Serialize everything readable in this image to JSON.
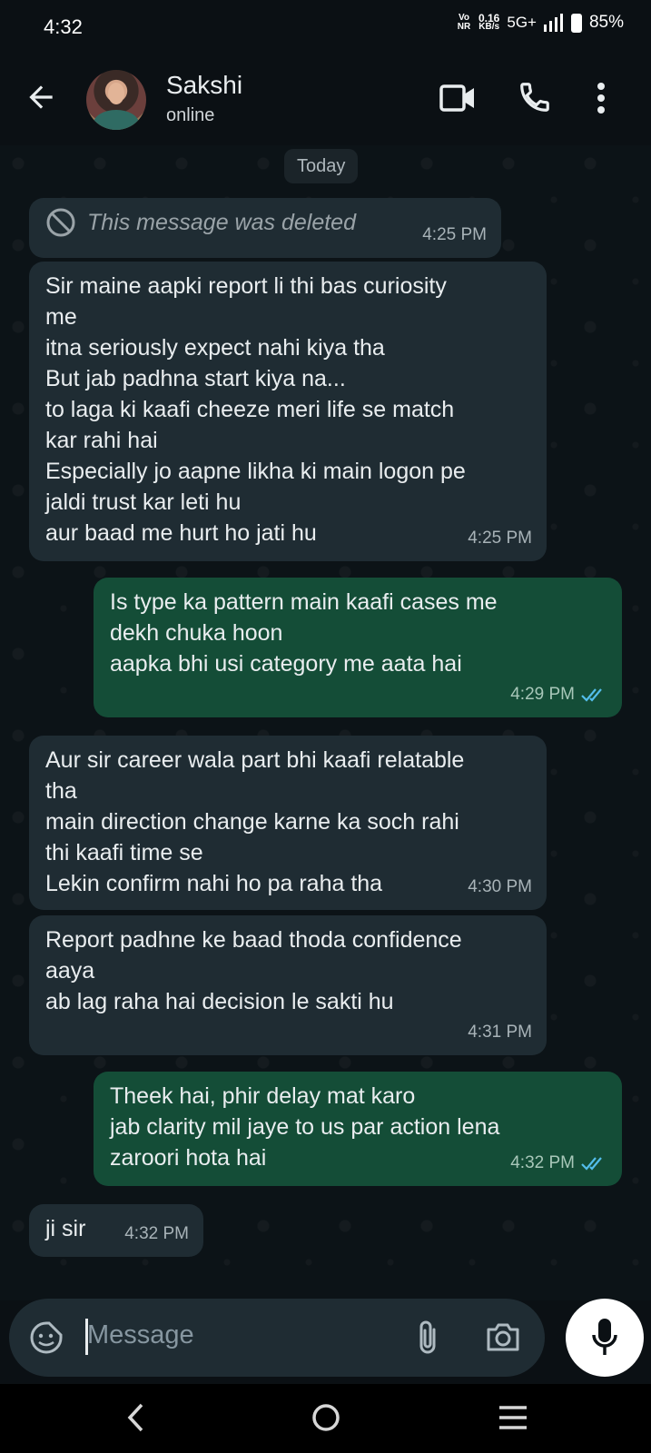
{
  "status_bar": {
    "time": "4:32",
    "volte": "Vo NR",
    "speed_value": "0.16",
    "speed_unit": "KB/s",
    "network": "5G+",
    "battery": "85%"
  },
  "header": {
    "contact_name": "Sakshi",
    "contact_status": "online",
    "icons": [
      "back-arrow-icon",
      "video-call-icon",
      "phone-icon",
      "more-vert-icon"
    ]
  },
  "chat": {
    "date_chip": "Today",
    "messages": [
      {
        "direction": "in",
        "deleted": true,
        "text": "This message was deleted",
        "time": "4:25 PM"
      },
      {
        "direction": "in",
        "text": "Sir maine aapki report li thi bas curiosity\nme\nitna seriously expect nahi kiya tha\nBut jab padhna start kiya na...\nto laga ki kaafi cheeze meri life se match\nkar rahi hai\nEspecially jo aapne likha ki main logon pe\njaldi trust kar leti hu\naur baad me hurt ho jati hu",
        "time": "4:25 PM"
      },
      {
        "direction": "out",
        "text": "Is type ka pattern main kaafi cases me\ndekh chuka hoon\naapka bhi usi category me aata hai",
        "time": "4:29 PM",
        "read": true
      },
      {
        "direction": "in",
        "text": "Aur sir career wala part bhi kaafi relatable\ntha\nmain direction change karne ka soch rahi\nthi kaafi time se\nLekin confirm nahi ho pa raha tha",
        "time": "4:30 PM"
      },
      {
        "direction": "in",
        "text": "Report padhne ke baad thoda confidence\naaya\nab lag raha hai decision le sakti hu",
        "time": "4:31 PM"
      },
      {
        "direction": "out",
        "text": "Theek hai, phir delay mat karo\njab clarity mil jaye to us par action lena\nzaroori hota hai",
        "time": "4:32 PM",
        "read": true
      },
      {
        "direction": "in",
        "text": "ji sir",
        "time": "4:32 PM"
      }
    ]
  },
  "composer": {
    "placeholder": "Message",
    "icons": [
      "emoji-sticker-icon",
      "attach-icon",
      "camera-icon",
      "mic-icon"
    ]
  },
  "colors": {
    "incoming_bubble": "#1f2c33",
    "outgoing_bubble": "#144d37",
    "read_ticks": "#53bdeb",
    "background": "#0b1014"
  }
}
